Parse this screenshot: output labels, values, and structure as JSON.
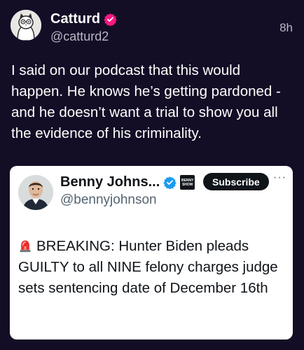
{
  "author": {
    "name": "Catturd",
    "handle": "@catturd2",
    "timestamp": "8h",
    "verified": true
  },
  "post": {
    "text": "I said on our podcast that this would happen. He knows he’s getting pardoned - and he doesn’t want a trial to show you all the evidence of his criminality."
  },
  "quoted": {
    "name": "Benny Johns...",
    "handle": "@bennyjohnson",
    "show_logo_text": "BENNY SHOW",
    "subscribe_label": "Subscribe",
    "more_label": "···",
    "text": "BREAKING: Hunter Biden pleads GUILTY to all NINE felony charges judge sets sentencing date of December 16th",
    "emoji_icon": "police-siren-icon"
  },
  "colors": {
    "background": "#140d26",
    "verified_badge": "#f91880",
    "quoted_verified_badge": "#1d9bf0",
    "card_background": "#ffffff"
  }
}
